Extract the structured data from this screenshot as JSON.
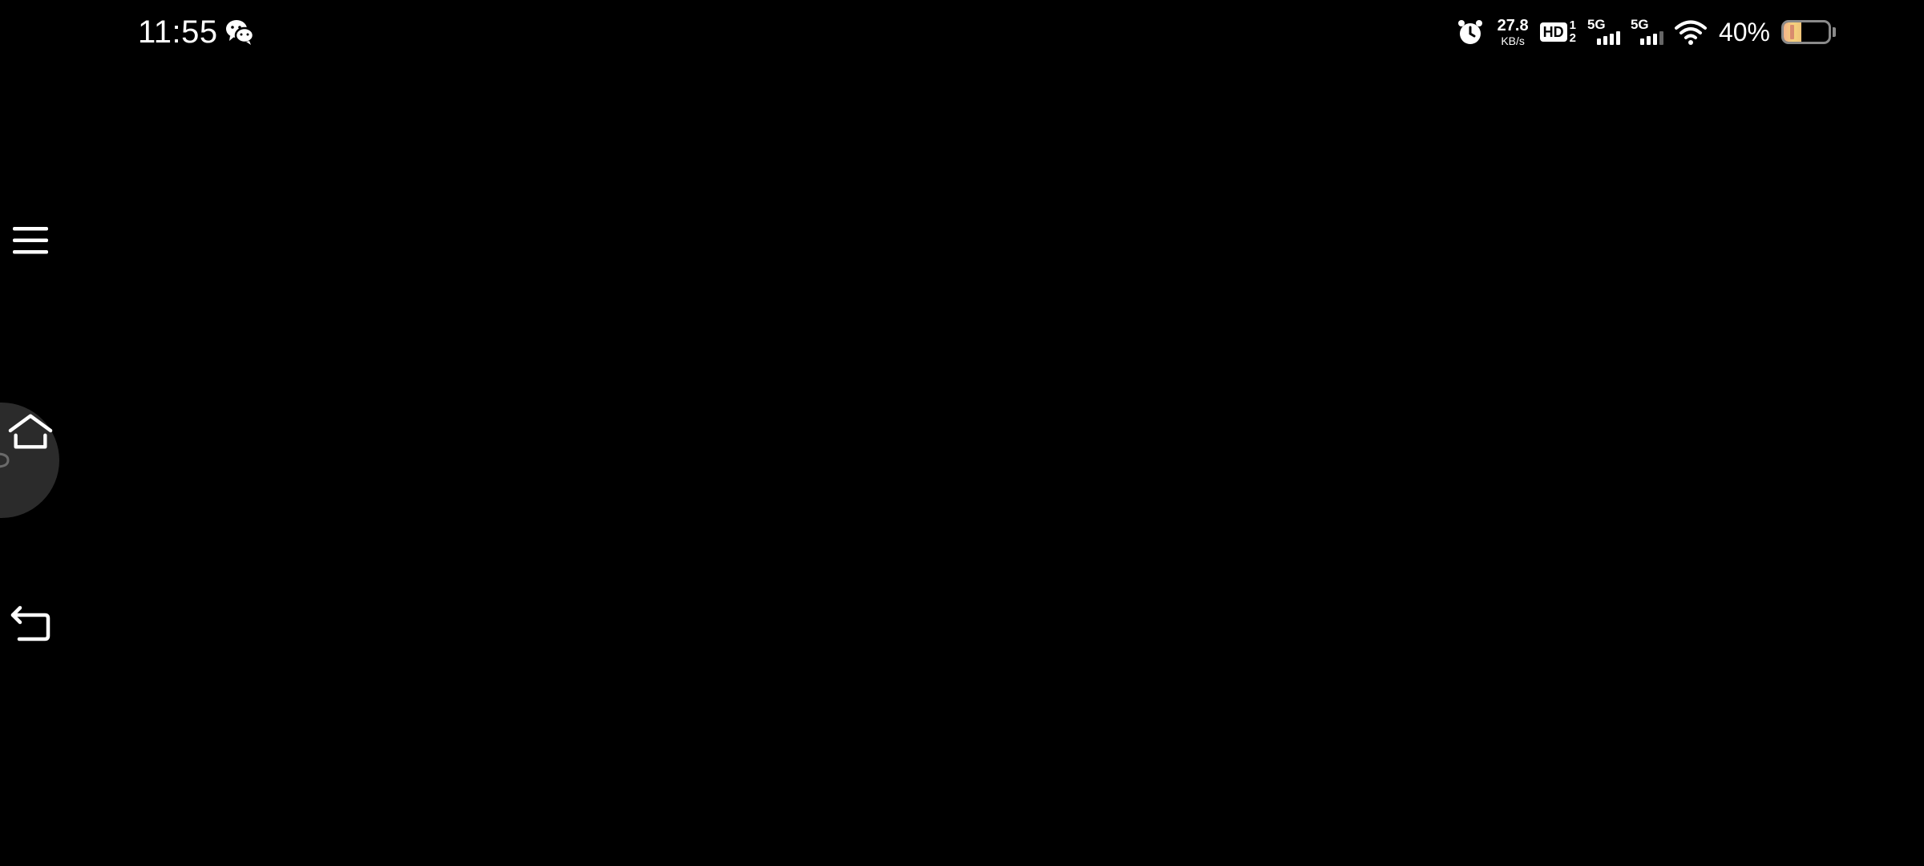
{
  "status_bar": {
    "time": "11:55",
    "notification_icons": [
      "wechat-icon"
    ],
    "icons": [
      "alarm-icon",
      "hd-volte-icon",
      "signal-5g-sim1-icon",
      "signal-5g-sim2-icon",
      "wifi-icon",
      "battery-icon"
    ],
    "network_speed_value": "27.8",
    "network_speed_unit": "KB/s",
    "hd_label": "HD",
    "hd_sim_top": "1",
    "hd_sim_bottom": "2",
    "sim1_network": "5G",
    "sim2_network": "5G",
    "battery_percent": "40%",
    "battery_level": 0.4,
    "colors": {
      "battery_fill": "#f6d27c",
      "icon": "#ffffff"
    }
  },
  "side_nav": {
    "buttons": [
      "menu-icon",
      "home-icon",
      "back-icon"
    ]
  },
  "assistive_ball": {
    "icon": "assistive-touch-icon"
  },
  "colors": {
    "background": "#000000",
    "foreground": "#ffffff",
    "assistive_ball": "#2b2b2b"
  }
}
